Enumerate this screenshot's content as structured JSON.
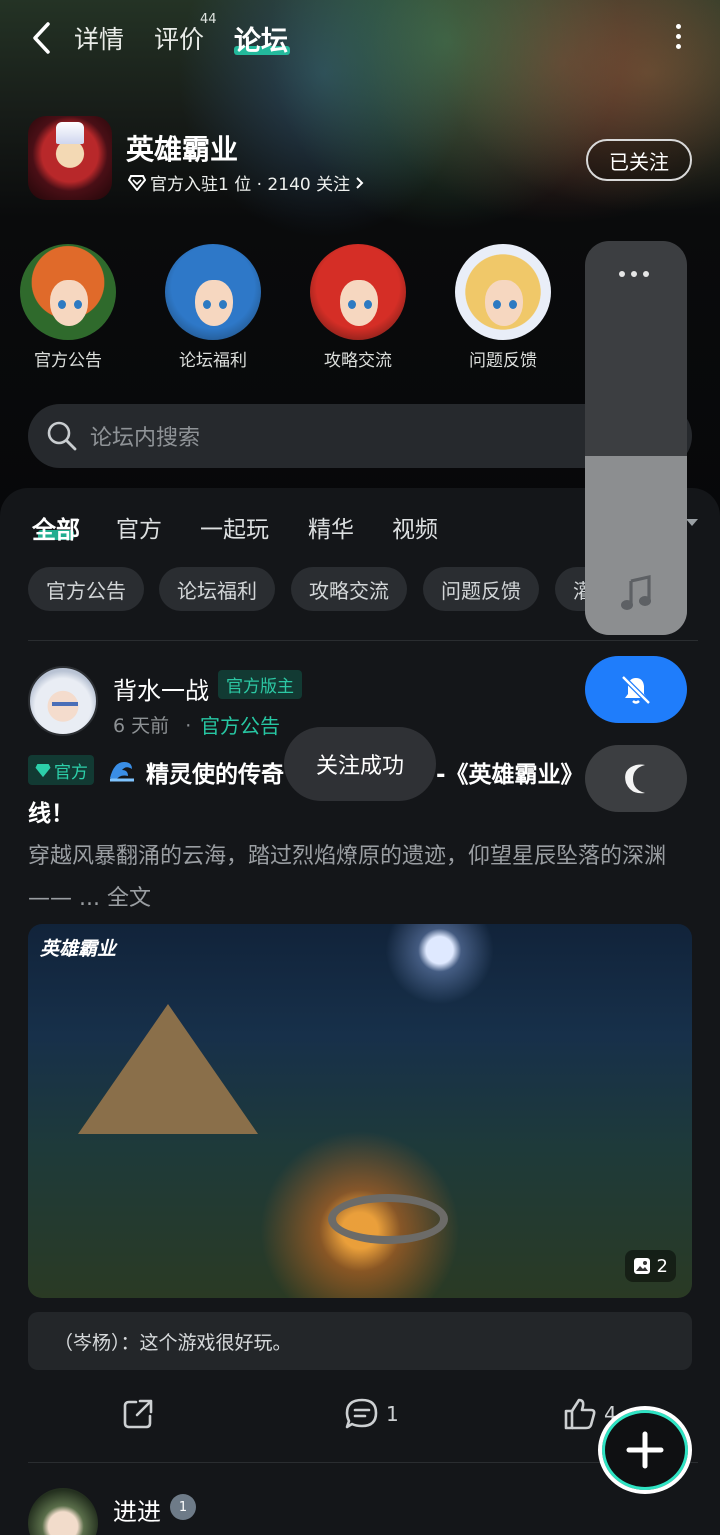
{
  "top_tabs": [
    {
      "label": "详情"
    },
    {
      "label": "评价",
      "badge": "44"
    },
    {
      "label": "论坛",
      "active": true
    }
  ],
  "game": {
    "name": "英雄霸业",
    "meta": "官方入驻1 位 · 2140 关注",
    "follow_label": "已关注"
  },
  "quick_sections": [
    {
      "label": "官方公告",
      "hair": "#e06a2a"
    },
    {
      "label": "论坛福利",
      "hair": "#2e78c8"
    },
    {
      "label": "攻略交流",
      "hair": "#d52e26"
    },
    {
      "label": "问题反馈",
      "hair": "#f0c869"
    }
  ],
  "search": {
    "placeholder": "论坛内搜索"
  },
  "filter_tabs": [
    "全部",
    "官方",
    "一起玩",
    "精华",
    "视频"
  ],
  "chips": [
    "官方公告",
    "论坛福利",
    "攻略交流",
    "问题反馈",
    "灌"
  ],
  "post": {
    "author": "背水一战",
    "role_badge": "官方版主",
    "time": "6 天前",
    "dot": "·",
    "category": "官方公告",
    "official_tag": "官方",
    "title_part1": "精灵使的传奇",
    "title_part2": "-《英雄霸业》",
    "title_line2": "线！",
    "body": "穿越风暴翻涌的云海，踏过烈焰燎原的遗迹，仰望星辰坠落的深渊——",
    "more": " ... 全文",
    "image_logo": "英雄霸业",
    "image_count": "2",
    "comment": "（岑杨）：这个游戏很好玩。",
    "comment_count": "1",
    "like_count": "4"
  },
  "next_post": {
    "author": "进进",
    "badge": "1"
  },
  "toast": "关注成功",
  "colors": {
    "accent": "#24c8a6",
    "blue": "#1f7dfb",
    "panel": "#141619"
  }
}
